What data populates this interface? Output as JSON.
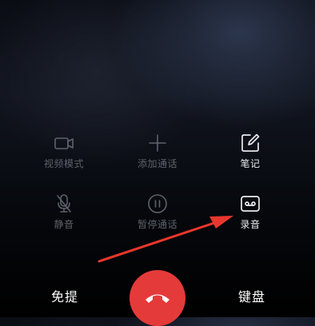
{
  "controls": {
    "video_mode": {
      "label": "视频模式",
      "icon": "video-camera-icon",
      "enabled": false
    },
    "add_call": {
      "label": "添加通话",
      "icon": "plus-icon",
      "enabled": false
    },
    "notes": {
      "label": "笔记",
      "icon": "note-edit-icon",
      "enabled": true
    },
    "mute": {
      "label": "静音",
      "icon": "microphone-off-icon",
      "enabled": false
    },
    "hold": {
      "label": "暂停通话",
      "icon": "pause-icon",
      "enabled": false
    },
    "record": {
      "label": "录音",
      "icon": "cassette-record-icon",
      "enabled": true
    }
  },
  "bottom_bar": {
    "handsfree_label": "免提",
    "end_call_icon": "phone-hangup-icon",
    "keypad_label": "键盘"
  },
  "colors": {
    "end_call": "#e53a3a",
    "annotation_arrow": "#e8372c",
    "enabled_text": "#e8eaee",
    "disabled_text": "#5d626c"
  }
}
